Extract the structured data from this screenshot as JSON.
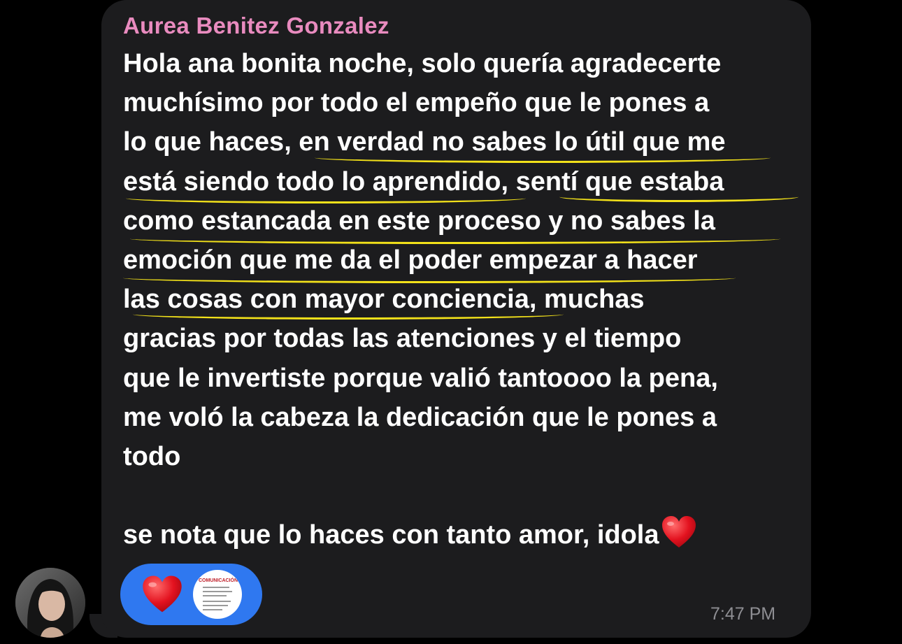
{
  "sender": {
    "name": "Aurea Benitez Gonzalez",
    "name_color": "#e98bbf"
  },
  "message": {
    "lines": [
      "Hola ana bonita noche, solo quería agradecerte",
      "muchísimo por todo el empeño que le pones a",
      "lo que haces, en verdad no sabes lo útil que me",
      "está siendo todo lo aprendido, sentí que estaba",
      "como estancada en este proceso y no sabes la",
      "emoción que me da el poder empezar a hacer",
      "las cosas con mayor conciencia, muchas",
      "gracias por todas las atenciones y el tiempo",
      "que le invertiste porque valió tantoooo la pena,",
      "me voló la cabeza la dedicación que le pones a",
      "todo",
      "",
      "se nota que lo haces con tanto amor, idola"
    ],
    "trailing_icon": "red-heart-icon",
    "underline_color": "#f2e11a"
  },
  "reactions": {
    "items": [
      {
        "icon": "red-heart-icon"
      },
      {
        "icon": "sticker-thumbnail",
        "thumbnail_title": "COMUNICACIÓN"
      }
    ],
    "background": "#2f78f0"
  },
  "timestamp": "7:47 PM",
  "avatar": {
    "icon": "user-avatar"
  }
}
